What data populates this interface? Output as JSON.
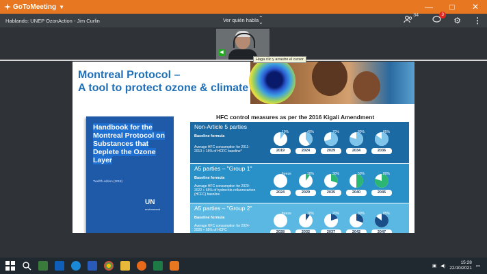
{
  "app": {
    "brand": "GoToMeeting",
    "window_controls": [
      "—",
      "□",
      "✕"
    ]
  },
  "controls": {
    "speaking": "Hablando: UNEP OzonAction - Jim Curlin",
    "viewer_select": "Ver quién habla",
    "attendees_count": "34",
    "chat_badge": "3"
  },
  "video": {
    "tooltip": "Haga clic y arrastre el cursor"
  },
  "slide": {
    "title_line1": "Montreal Protocol –",
    "title_line2": "A tool to protect ozone & climate",
    "handbook_title": "Handbook for the Montreal Protocol on Substances that Deplete the Ozone Layer",
    "handbook_edition": "Twelfth edition (2018)",
    "un_mark": "UN",
    "un_sub": "environment",
    "hfc_title": "HFC control measures as per the 2016 Kigali Amendment",
    "groups": [
      {
        "name": "Non-Article 5 parties",
        "baseline": "Baseline formula",
        "avg": "Average HFC consumption for 2011-2013 + 15% of HCFC baseline*",
        "steps": [
          {
            "label": "10%",
            "year": "2019",
            "fill": 0.1
          },
          {
            "label": "40%",
            "year": "2024",
            "fill": 0.4
          },
          {
            "label": "70%",
            "year": "2029",
            "fill": 0.7
          },
          {
            "label": "80%",
            "year": "2034",
            "fill": 0.8
          },
          {
            "label": "85%",
            "year": "2036",
            "fill": 0.85
          }
        ]
      },
      {
        "name": "A5 parties – \"Group 1\"",
        "baseline": "Baseline formula",
        "avg": "Average HFC consumption for 2020-2022 + 65% of hydrochlo-rofluorocarbon (HCFC) baseline",
        "steps": [
          {
            "label": "freeze",
            "year": "2024",
            "fill": 0
          },
          {
            "label": "10%",
            "year": "2029",
            "fill": 0.1
          },
          {
            "label": "30%",
            "year": "2035",
            "fill": 0.3
          },
          {
            "label": "50%",
            "year": "2040",
            "fill": 0.5
          },
          {
            "label": "80%",
            "year": "2045",
            "fill": 0.8
          }
        ]
      },
      {
        "name": "A5 parties – \"Group 2\"",
        "baseline": "Baseline formula",
        "avg": "Average HFC consumption for 2024-2026 + 65% of HCFC",
        "steps": [
          {
            "label": "freeze",
            "year": "2028",
            "fill": 0
          },
          {
            "label": "10%",
            "year": "2032",
            "fill": 0.1
          },
          {
            "label": "20%",
            "year": "2037",
            "fill": 0.2
          },
          {
            "label": "30%",
            "year": "2042",
            "fill": 0.3
          },
          {
            "label": "85%",
            "year": "2047",
            "fill": 0.85
          }
        ]
      }
    ]
  },
  "taskbar": {
    "time": "15:28",
    "date": "22/10/2021"
  },
  "colors": {
    "brand_orange": "#e87722",
    "title_blue": "#1f6fb8",
    "group1_fill": "#2bb673",
    "group2_fill": "#1b4f8a"
  }
}
